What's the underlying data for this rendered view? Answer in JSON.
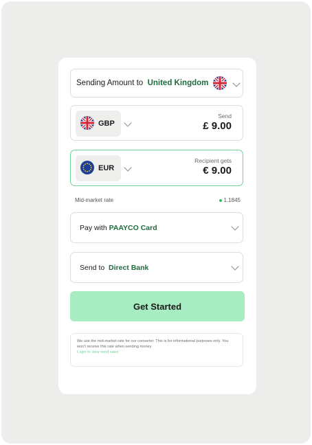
{
  "destination": {
    "prefix": "Sending Amount to",
    "country": "United Kingdom",
    "flag_icon": "uk-flag-icon"
  },
  "send": {
    "currency": "GBP",
    "flag_icon": "uk-flag-icon",
    "label": "Send",
    "amount": "£ 9.00"
  },
  "receive": {
    "currency": "EUR",
    "flag_icon": "eu-flag-icon",
    "label": "Recipient gets",
    "amount": "€ 9.00"
  },
  "rate": {
    "label": "Mid-market rate",
    "value": "1.1845"
  },
  "pay_with": {
    "prefix": "Pay with",
    "method": "PAAYCO Card"
  },
  "send_to": {
    "prefix": "Send to",
    "method": "Direct Bank"
  },
  "cta": {
    "label": "Get Started"
  },
  "note": {
    "text": "We use the mid-market rate for our converter. This is for informational purposes only. You won't receive this rate when sending money",
    "link": "Login to view send rates"
  },
  "colors": {
    "accent_green": "#1e6b3d",
    "button_bg": "#a8edc1",
    "highlight_border": "#6fd49a"
  }
}
